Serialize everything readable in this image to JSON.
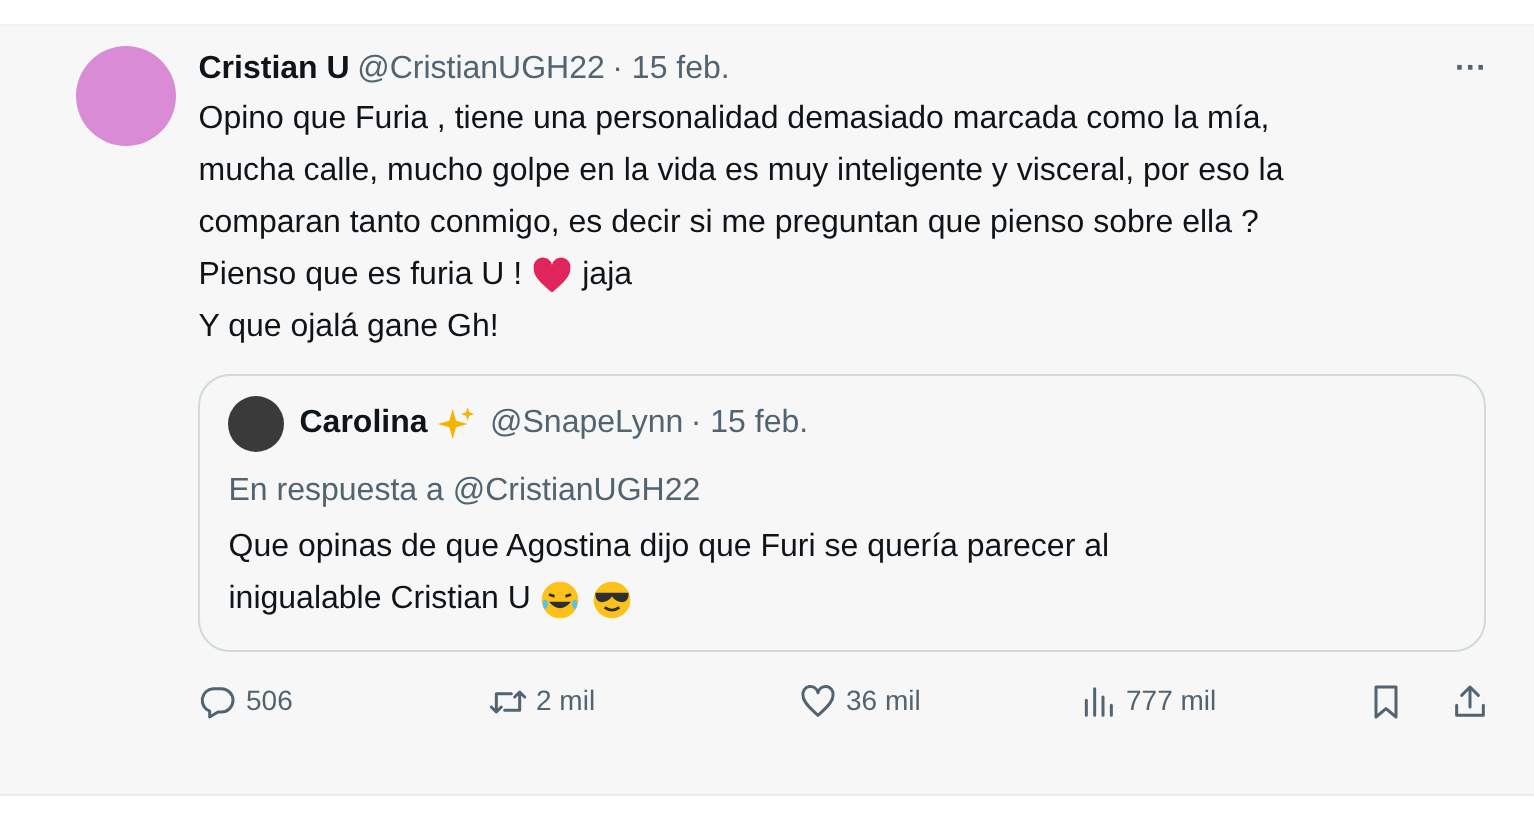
{
  "tweet": {
    "name": "Cristian U",
    "handle": "@CristianUGH22",
    "date": "· 15 feb.",
    "more": "···",
    "lines": [
      [
        {
          "kind": "text",
          "text": "Opino que Furia , tiene una personalidad demasiado marcada como la mía,"
        }
      ],
      [
        {
          "kind": "text",
          "text": "mucha calle, mucho golpe en la vida es muy inteligente y visceral, por eso la"
        }
      ],
      [
        {
          "kind": "text",
          "text": "comparan tanto conmigo,  es decir si me preguntan que pienso sobre ella ?"
        }
      ],
      [
        {
          "kind": "text",
          "text": "Pienso que es furia U !"
        },
        {
          "kind": "heart"
        },
        {
          "kind": "text",
          "text": "jaja"
        }
      ],
      [
        {
          "kind": "text",
          "text": "Y que ojalá gane Gh!"
        }
      ]
    ],
    "quote": {
      "name": [
        {
          "kind": "text",
          "text": "Carolina"
        },
        {
          "kind": "sparkles"
        }
      ],
      "handle": "@SnapeLynn",
      "date": "· 15 feb.",
      "reply_to": "En respuesta a @CristianUGH22",
      "lines": [
        [
          {
            "kind": "text",
            "text": "Que opinas de que Agostina dijo que Furi se quería parecer al"
          }
        ],
        [
          {
            "kind": "text",
            "text": "inigualable Cristian U"
          },
          {
            "kind": "laugh"
          },
          {
            "kind": "cool"
          }
        ]
      ]
    },
    "actions": [
      {
        "kind": "reply",
        "count": "506"
      },
      {
        "kind": "retweet",
        "count": "2 mil"
      },
      {
        "kind": "like",
        "count": "36 mil"
      },
      {
        "kind": "views",
        "count": "777 mil"
      },
      {
        "kind": "bookmark"
      },
      {
        "kind": "share"
      }
    ]
  }
}
